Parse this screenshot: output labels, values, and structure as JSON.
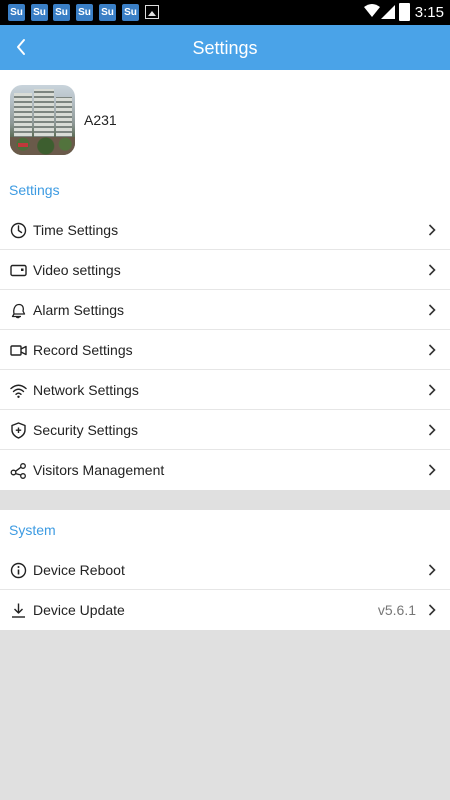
{
  "statusbar": {
    "time": "3:15",
    "notification_icons": [
      "app-notification-icon",
      "app-notification-icon",
      "app-notification-icon",
      "app-notification-icon",
      "app-notification-icon",
      "app-notification-icon"
    ],
    "notification_glyph": "ꜱ͟ᴜ"
  },
  "header": {
    "title": "Settings",
    "color": "#4aa3e8"
  },
  "device": {
    "name": "A231"
  },
  "settings_section": {
    "title": "Settings",
    "items": [
      {
        "label": "Time Settings",
        "icon": "clock-icon"
      },
      {
        "label": "Video settings",
        "icon": "video-display-icon"
      },
      {
        "label": "Alarm Settings",
        "icon": "bell-icon"
      },
      {
        "label": "Record Settings",
        "icon": "video-camera-icon"
      },
      {
        "label": "Network Settings",
        "icon": "wifi-icon"
      },
      {
        "label": "Security Settings",
        "icon": "shield-plus-icon"
      },
      {
        "label": "Visitors Management",
        "icon": "share-nodes-icon"
      }
    ]
  },
  "system_section": {
    "title": "System",
    "items": [
      {
        "label": "Device Reboot",
        "icon": "info-icon",
        "value": ""
      },
      {
        "label": "Device Update",
        "icon": "download-icon",
        "value": "v5.6.1"
      }
    ]
  },
  "accent_color": "#3d9be2"
}
